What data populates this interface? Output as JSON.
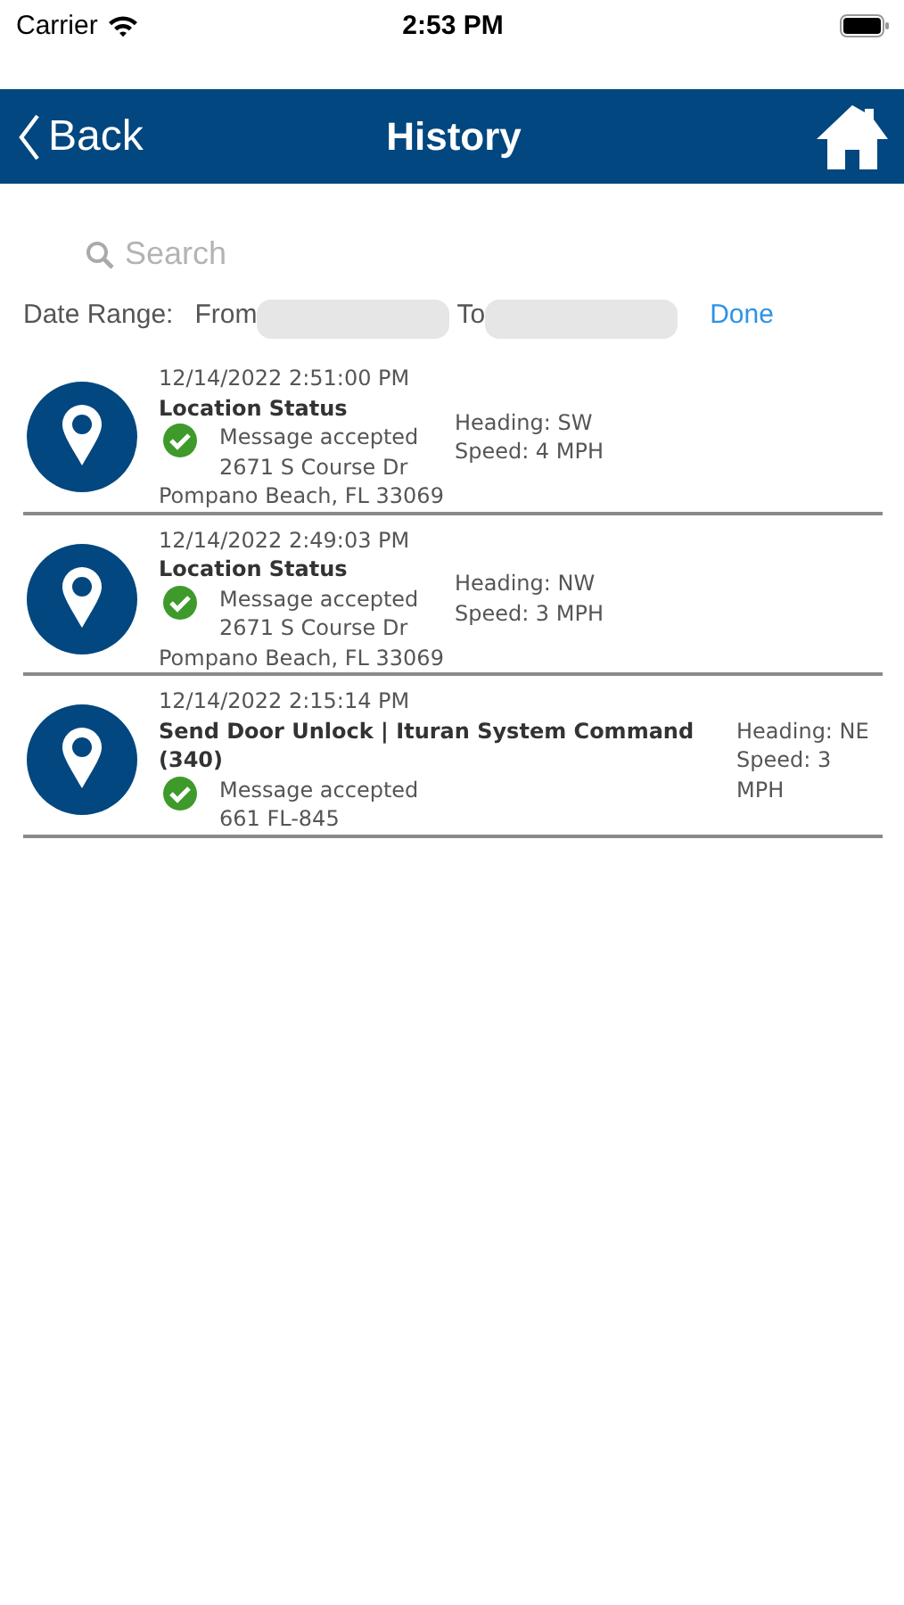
{
  "status_bar": {
    "carrier": "Carrier",
    "time": "2:53 PM"
  },
  "nav_bar": {
    "back": "Back",
    "title": "History"
  },
  "search": {
    "placeholder": "Search"
  },
  "date_range": {
    "label": "Date Range:",
    "from_label": "From",
    "to_label": "To",
    "done": "Done"
  },
  "entries": [
    {
      "timestamp": "12/14/2022 2:51:00 PM",
      "title": "Location Status",
      "status": "Message accepted",
      "address_lines": [
        "2671 S Course Dr",
        "Pompano Beach, FL 33069"
      ],
      "heading": "Heading: SW",
      "speed": "Speed: 4 MPH"
    },
    {
      "timestamp": "12/14/2022 2:49:03 PM",
      "title": "Location Status",
      "status": "Message accepted",
      "address_lines": [
        "2671 S Course Dr",
        "Pompano Beach, FL 33069"
      ],
      "heading": "Heading: NW",
      "speed": "Speed: 3 MPH"
    },
    {
      "timestamp": "12/14/2022 2:15:14 PM",
      "title": "Send Door Unlock | Ituran System Command (340)",
      "status": "Message accepted",
      "address_lines": [
        "661 FL-845"
      ],
      "heading": "Heading: NE",
      "speed": "Speed: 3 MPH"
    }
  ]
}
